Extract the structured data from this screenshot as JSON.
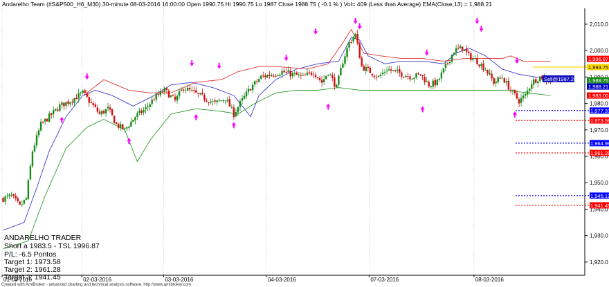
{
  "header": {
    "title": "Andarelho Team (#S&P500_H6_M30) 30-minute  08-03-2016 16:00:00   Open 1990.75  Hi 1990.75  Lo 1987  Close 1988.75  ( -0.1 % )  Vol= 409 (Less than Average)  EMA(Close,13) = 1,988.21"
  },
  "footer": {
    "credit": "Created with AmiBroker - advanced charting and technical analysis software. http://www.amibroker.com"
  },
  "info_panel": {
    "name": "ANDARELHO TRADER",
    "line1": "Short a 1983.5 - TSL 1996.87",
    "line2": " P/L: -6.5 Pontos",
    "line3": "Target 1: 1973.58",
    "line4": "Target 2: 1961.28",
    "line5": "Target 3: 1941.45"
  },
  "signal_label": "Sell@1987.25",
  "colors": {
    "up": "#1a8a1a",
    "down": "#d01010",
    "upper_band": "#3a3ad0",
    "lower_band": "#2a9a2a",
    "red_line": "#e03030",
    "arrow": "#ff00ff",
    "target_blue": "#0000ff",
    "target_red": "#ff0000"
  },
  "chart_data": {
    "type": "candlestick",
    "ylim": [
      1915,
      2016
    ],
    "y_ticks": [
      "2,010.0",
      "2,000.0",
      "1,990.0",
      "1,980.0",
      "1,970.0",
      "1,960.0",
      "1,950.0",
      "1,940.0",
      "1,930.0",
      "1,920.0"
    ],
    "y_tick_values": [
      2010,
      2000,
      1990,
      1980,
      1970,
      1960,
      1950,
      1940,
      1930,
      1920
    ],
    "x_labels": [
      "01-03-2016",
      "02-03-2016",
      "03-03-2016",
      "04-03-2016",
      "07-03-2016",
      "08-03-2016"
    ],
    "x_label_bar": [
      0,
      38,
      77,
      126,
      175,
      225
    ],
    "bar_count": 262,
    "close_anchors": [
      [
        0,
        1944
      ],
      [
        4,
        1945
      ],
      [
        8,
        1941
      ],
      [
        11,
        1944
      ],
      [
        14,
        1962
      ],
      [
        18,
        1972
      ],
      [
        22,
        1975
      ],
      [
        27,
        1979
      ],
      [
        32,
        1981
      ],
      [
        38,
        1984
      ],
      [
        42,
        1980
      ],
      [
        46,
        1976
      ],
      [
        50,
        1978
      ],
      [
        54,
        1972
      ],
      [
        58,
        1970
      ],
      [
        63,
        1975
      ],
      [
        68,
        1978
      ],
      [
        72,
        1982
      ],
      [
        77,
        1985
      ],
      [
        82,
        1981
      ],
      [
        86,
        1986
      ],
      [
        91,
        1984
      ],
      [
        96,
        1982
      ],
      [
        101,
        1980
      ],
      [
        106,
        1982
      ],
      [
        110,
        1976
      ],
      [
        113,
        1980
      ],
      [
        118,
        1986
      ],
      [
        123,
        1990
      ],
      [
        128,
        1991
      ],
      [
        133,
        1992
      ],
      [
        138,
        1991
      ],
      [
        143,
        1990
      ],
      [
        148,
        1992
      ],
      [
        152,
        1988
      ],
      [
        155,
        1992
      ],
      [
        159,
        1986
      ],
      [
        162,
        1996
      ],
      [
        165,
        2003
      ],
      [
        168,
        2006
      ],
      [
        171,
        1994
      ],
      [
        175,
        1992
      ],
      [
        179,
        1990
      ],
      [
        183,
        1993
      ],
      [
        187,
        1992
      ],
      [
        191,
        1991
      ],
      [
        195,
        1990
      ],
      [
        199,
        1991
      ],
      [
        203,
        1987
      ],
      [
        207,
        1988
      ],
      [
        211,
        1994
      ],
      [
        215,
        2000
      ],
      [
        219,
        2001
      ],
      [
        222,
        1998
      ],
      [
        226,
        1996
      ],
      [
        230,
        1993
      ],
      [
        234,
        1988
      ],
      [
        238,
        1990
      ],
      [
        242,
        1985
      ],
      [
        246,
        1981
      ],
      [
        249,
        1983
      ],
      [
        252,
        1988
      ],
      [
        256,
        1990
      ],
      [
        261,
        1988.75
      ]
    ],
    "upper_band_anchors": [
      [
        0,
        1932
      ],
      [
        10,
        1935
      ],
      [
        16,
        1948
      ],
      [
        22,
        1962
      ],
      [
        30,
        1975
      ],
      [
        38,
        1983
      ],
      [
        44,
        1985
      ],
      [
        52,
        1983
      ],
      [
        62,
        1979
      ],
      [
        72,
        1983
      ],
      [
        80,
        1987
      ],
      [
        90,
        1988
      ],
      [
        100,
        1986
      ],
      [
        110,
        1983
      ],
      [
        118,
        1975
      ],
      [
        122,
        1983
      ],
      [
        130,
        1989
      ],
      [
        140,
        1993
      ],
      [
        150,
        1995
      ],
      [
        160,
        1996
      ],
      [
        166,
        2005
      ],
      [
        170,
        2004
      ],
      [
        174,
        1998
      ],
      [
        182,
        1995
      ],
      [
        190,
        1996
      ],
      [
        200,
        1996
      ],
      [
        210,
        1995
      ],
      [
        216,
        1999
      ],
      [
        222,
        2001
      ],
      [
        230,
        1998
      ],
      [
        238,
        1993
      ],
      [
        246,
        1991
      ],
      [
        254,
        1990
      ],
      [
        261,
        1990
      ]
    ],
    "lower_band_anchors": [
      [
        0,
        1925
      ],
      [
        12,
        1928
      ],
      [
        20,
        1945
      ],
      [
        30,
        1963
      ],
      [
        40,
        1971
      ],
      [
        48,
        1974
      ],
      [
        58,
        1970
      ],
      [
        64,
        1958
      ],
      [
        70,
        1966
      ],
      [
        80,
        1976
      ],
      [
        92,
        1978
      ],
      [
        104,
        1977
      ],
      [
        112,
        1976
      ],
      [
        120,
        1980
      ],
      [
        130,
        1984
      ],
      [
        140,
        1985
      ],
      [
        150,
        1985
      ],
      [
        160,
        1986
      ],
      [
        170,
        1985
      ],
      [
        180,
        1985
      ],
      [
        190,
        1985
      ],
      [
        200,
        1985
      ],
      [
        210,
        1985
      ],
      [
        220,
        1985
      ],
      [
        230,
        1985
      ],
      [
        240,
        1985
      ],
      [
        250,
        1984
      ],
      [
        261,
        1983
      ]
    ],
    "red_line_anchors": [
      [
        40,
        1984
      ],
      [
        48,
        1989
      ],
      [
        60,
        1985
      ],
      [
        70,
        1984
      ],
      [
        80,
        1984
      ],
      [
        92,
        1988
      ],
      [
        104,
        1989
      ],
      [
        112,
        1992
      ],
      [
        122,
        1994
      ],
      [
        130,
        1994
      ],
      [
        145,
        1993
      ],
      [
        155,
        1995
      ],
      [
        162,
        2003
      ],
      [
        166,
        2008
      ],
      [
        172,
        1999
      ],
      [
        180,
        1998
      ],
      [
        190,
        1997
      ],
      [
        200,
        1997
      ],
      [
        210,
        1996
      ],
      [
        220,
        1997
      ],
      [
        230,
        1997
      ],
      [
        238,
        1997
      ],
      [
        242,
        1998
      ],
      [
        248,
        1996
      ],
      [
        261,
        1996
      ]
    ],
    "current_price_line": 1993.75,
    "right_tags": [
      {
        "value": 1996.87,
        "label": "1,996.87",
        "bg": "#ff0000",
        "dark": false
      },
      {
        "value": 1993.75,
        "label": "1,993.75",
        "bg": "#ffd700",
        "dark": true
      },
      {
        "value": 1988.75,
        "label": "1,988.75",
        "bg": "#1a8a1a",
        "dark": false
      },
      {
        "value": 1988.21,
        "label": "1,988.21",
        "bg": "#0000cc",
        "dark": false
      },
      {
        "value": 1983.0,
        "label": "1,983.00",
        "bg": "#ff0000",
        "dark": false
      }
    ],
    "targets": [
      {
        "value": 1977.31,
        "label": "1,977.31",
        "color": "#0000ff",
        "bg": "#0000ff"
      },
      {
        "value": 1973.58,
        "label": "1,973.58",
        "color": "#ff0000",
        "bg": "#ff0000"
      },
      {
        "value": 1964.99,
        "label": "1,964.99",
        "color": "#0000ff",
        "bg": "#0000ff"
      },
      {
        "value": 1961.28,
        "label": "1,961.28",
        "color": "#ff0000",
        "bg": "#ff0000"
      },
      {
        "value": 1945.12,
        "label": "1,945.12",
        "color": "#0000ff",
        "bg": "#0000ff"
      },
      {
        "value": 1941.45,
        "label": "1,941.45",
        "color": "#ff0000",
        "bg": "#ff0000"
      }
    ],
    "arrows_up": [
      [
        28,
        1975
      ],
      [
        60,
        1967
      ],
      [
        92,
        1976
      ],
      [
        110,
        1973
      ],
      [
        155,
        1980
      ],
      [
        200,
        1979
      ],
      [
        244,
        1977
      ]
    ],
    "arrows_down": [
      [
        40,
        1989
      ],
      [
        90,
        1994
      ],
      [
        103,
        1993
      ],
      [
        135,
        1996
      ],
      [
        149,
        2006
      ],
      [
        168,
        2010
      ],
      [
        170,
        2008
      ],
      [
        202,
        1998
      ],
      [
        226,
        2010
      ],
      [
        228,
        2007
      ],
      [
        245,
        1995
      ]
    ]
  }
}
